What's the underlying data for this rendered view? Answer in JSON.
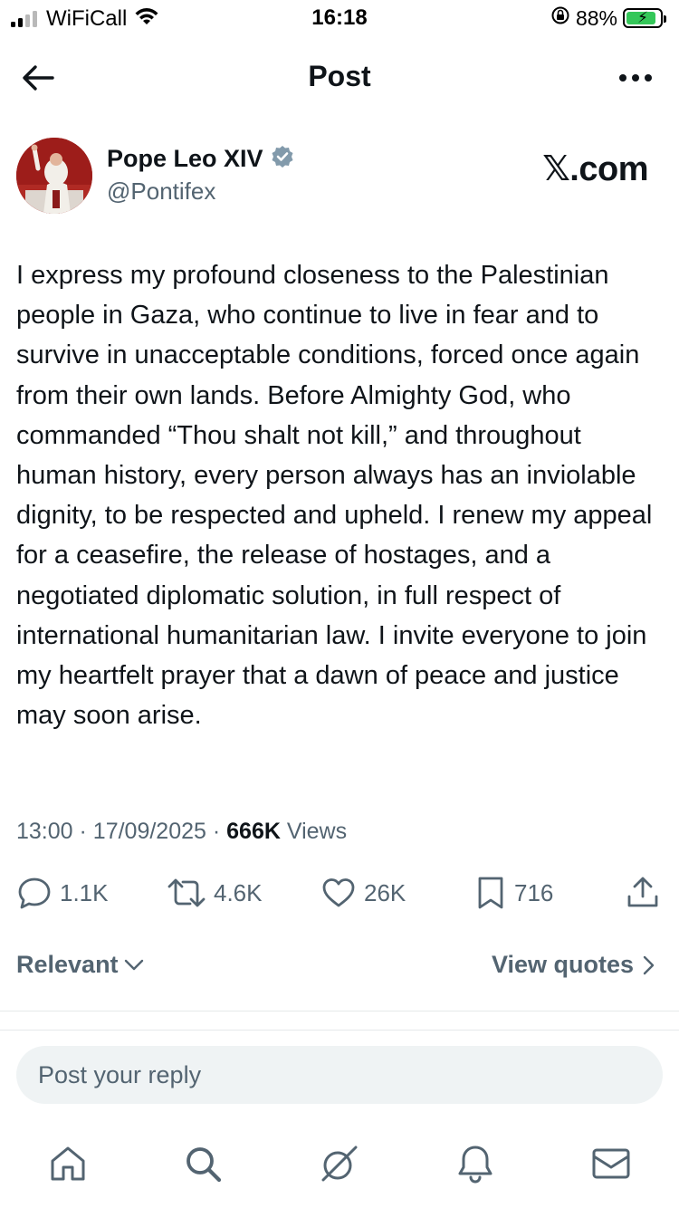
{
  "status_bar": {
    "carrier": "WiFiCall",
    "time": "16:18",
    "battery_percent": "88%",
    "battery_level": 0.88,
    "signal_bars_active": 2,
    "signal_bars_total": 4
  },
  "header": {
    "title": "Post"
  },
  "author": {
    "name": "Pope Leo XIV",
    "handle": "@Pontifex",
    "verified": true
  },
  "watermark": "𝕏.com",
  "post": {
    "text": "I express my profound closeness to the Palestinian people in Gaza, who continue to live in fear and to survive in unacceptable conditions, forced once again from their own lands. Before Almighty God, who commanded “Thou shalt not kill,” and throughout human history, every person always has an inviolable dignity, to be respected and upheld. I renew my appeal for a ceasefire, the release of hostages, and a negotiated diplomatic solution, in full respect of international humanitarian law. I invite everyone to join my heartfelt prayer that a dawn of peace and justice may soon arise.",
    "time": "13:00",
    "separator": "·",
    "date": "17/09/2025",
    "views_count": "666K",
    "views_label": "Views"
  },
  "actions": {
    "replies": "1.1K",
    "reposts": "4.6K",
    "likes": "26K",
    "bookmarks": "716"
  },
  "sort": {
    "label": "Relevant",
    "view_quotes": "View quotes"
  },
  "reply": {
    "placeholder": "Post your reply"
  },
  "colors": {
    "text": "#0f1419",
    "muted": "#536471",
    "verified": "#829aab",
    "reply_bg": "#eff3f4",
    "battery_fill": "#34c759"
  },
  "nav": [
    "home-icon",
    "search-icon",
    "grok-icon",
    "notifications-icon",
    "messages-icon"
  ]
}
